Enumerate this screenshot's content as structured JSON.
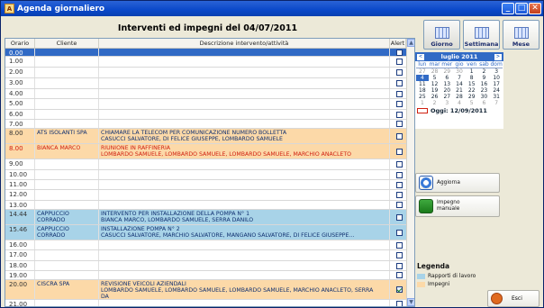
{
  "window": {
    "title": "Agenda giornaliero",
    "app_icon_letter": "A"
  },
  "header": {
    "title": "Interventi ed impegni del 04/07/2011"
  },
  "grid": {
    "columns": {
      "time": "Orario",
      "client": "Cliente",
      "desc": "Descrizione intervento/attività",
      "alert": "Alert"
    },
    "rows": [
      {
        "time": "0.00",
        "client": "",
        "desc": "",
        "style": "sel",
        "checked": false,
        "h": 9
      },
      {
        "time": "1.00",
        "client": "",
        "desc": "",
        "style": "",
        "checked": false,
        "h": 12
      },
      {
        "time": "2.00",
        "client": "",
        "desc": "",
        "style": "",
        "checked": false,
        "h": 12
      },
      {
        "time": "3.00",
        "client": "",
        "desc": "",
        "style": "",
        "checked": false,
        "h": 12
      },
      {
        "time": "4.00",
        "client": "",
        "desc": "",
        "style": "",
        "checked": false,
        "h": 11
      },
      {
        "time": "5.00",
        "client": "",
        "desc": "",
        "style": "",
        "checked": false,
        "h": 12
      },
      {
        "time": "6.00",
        "client": "",
        "desc": "",
        "style": "",
        "checked": false,
        "h": 11
      },
      {
        "time": "7.00",
        "client": "",
        "desc": "",
        "style": "",
        "checked": false,
        "h": 10
      },
      {
        "time": "8.00",
        "client": "ATS ISOLANTI SPA",
        "desc": "CHIAMARE LA TELECOM PER COMUNICAZIONE NUMERO BOLLETTA\nCASUCCI SALVATORE, DI FELICE GIUSEPPE, LOMBARDO SAMUELE",
        "style": "orange",
        "checked": false,
        "h": 17
      },
      {
        "time": "8.00",
        "client": "BIANCA MARCO",
        "desc": "RIUNIONE IN RAFFINERIA\nLOMBARDO SAMUELE, LOMBARDO SAMUELE, LOMBARDO SAMUELE, MARCHIO ANACLETO",
        "style": "orange red",
        "checked": false,
        "h": 17
      },
      {
        "time": "9.00",
        "client": "",
        "desc": "",
        "style": "",
        "checked": false,
        "h": 12
      },
      {
        "time": "10.00",
        "client": "",
        "desc": "",
        "style": "",
        "checked": false,
        "h": 11
      },
      {
        "time": "11.00",
        "client": "",
        "desc": "",
        "style": "",
        "checked": false,
        "h": 11
      },
      {
        "time": "12.00",
        "client": "",
        "desc": "",
        "style": "",
        "checked": false,
        "h": 12
      },
      {
        "time": "13.00",
        "client": "",
        "desc": "",
        "style": "",
        "checked": false,
        "h": 10
      },
      {
        "time": "14.44",
        "client": "CAPPUCCIO\nCORRADO",
        "desc": "INTERVENTO PER INSTALLAZIONE DELLA POMPA N° 1\nBIANCA MARCO, LOMBARDO SAMUELE, SERRA DANILO",
        "style": "blue",
        "checked": false,
        "h": 17
      },
      {
        "time": "15.46",
        "client": "CAPPUCCIO\nCORRADO",
        "desc": "INSTALLAZIONE POMPA N° 2\nCASUCCI SALVATORE, MARCHIO SALVATORE, MANGANO SALVATORE, DI FELICE GIUSEPPE...",
        "style": "blue",
        "checked": false,
        "h": 17
      },
      {
        "time": "16.00",
        "client": "",
        "desc": "",
        "style": "",
        "checked": false,
        "h": 11
      },
      {
        "time": "17.00",
        "client": "",
        "desc": "",
        "style": "",
        "checked": false,
        "h": 12
      },
      {
        "time": "18.00",
        "client": "",
        "desc": "",
        "style": "",
        "checked": false,
        "h": 11
      },
      {
        "time": "19.00",
        "client": "",
        "desc": "",
        "style": "",
        "checked": false,
        "h": 10
      },
      {
        "time": "20.00",
        "client": "CISCRA SPA",
        "desc": "REVISIONE VEICOLI AZIENDALI\nLOMBARDO SAMUELE, LOMBARDO SAMUELE, LOMBARDO SAMUELE, MARCHIO ANACLETO, SERRA\nDA",
        "style": "orange",
        "checked": true,
        "h": 22
      },
      {
        "time": "21.00",
        "client": "",
        "desc": "",
        "style": "",
        "checked": false,
        "h": 10
      }
    ]
  },
  "view_buttons": [
    {
      "label": "Giorno",
      "selected": true
    },
    {
      "label": "Settimana",
      "selected": false
    },
    {
      "label": "Mese",
      "selected": false
    }
  ],
  "calendar": {
    "month_label": "luglio 2011",
    "prev": "<",
    "next": ">",
    "day_names": [
      "lun",
      "mar",
      "mer",
      "gio",
      "ven",
      "sab",
      "dom"
    ],
    "weeks": [
      [
        [
          "27",
          "other"
        ],
        [
          "28",
          "other"
        ],
        [
          "29",
          "other"
        ],
        [
          "30",
          "other"
        ],
        [
          "1",
          ""
        ],
        [
          "2",
          ""
        ],
        [
          "3",
          ""
        ]
      ],
      [
        [
          "4",
          "today"
        ],
        [
          "5",
          ""
        ],
        [
          "6",
          ""
        ],
        [
          "7",
          ""
        ],
        [
          "8",
          ""
        ],
        [
          "9",
          ""
        ],
        [
          "10",
          ""
        ]
      ],
      [
        [
          "11",
          ""
        ],
        [
          "12",
          ""
        ],
        [
          "13",
          ""
        ],
        [
          "14",
          ""
        ],
        [
          "15",
          ""
        ],
        [
          "16",
          ""
        ],
        [
          "17",
          ""
        ]
      ],
      [
        [
          "18",
          ""
        ],
        [
          "19",
          ""
        ],
        [
          "20",
          ""
        ],
        [
          "21",
          ""
        ],
        [
          "22",
          ""
        ],
        [
          "23",
          ""
        ],
        [
          "24",
          ""
        ]
      ],
      [
        [
          "25",
          ""
        ],
        [
          "26",
          ""
        ],
        [
          "27",
          ""
        ],
        [
          "28",
          ""
        ],
        [
          "29",
          ""
        ],
        [
          "30",
          ""
        ],
        [
          "31",
          ""
        ]
      ],
      [
        [
          "1",
          "other"
        ],
        [
          "2",
          "other"
        ],
        [
          "3",
          "other"
        ],
        [
          "4",
          "other"
        ],
        [
          "5",
          "other"
        ],
        [
          "6",
          "other"
        ],
        [
          "7",
          "other"
        ]
      ]
    ],
    "today_label": "Oggi: 12/09/2011"
  },
  "actions": {
    "refresh_label": "Aggiorna",
    "new_appointment_label": "Impegno\nmanuale"
  },
  "legend": {
    "title": "Legenda",
    "items": [
      {
        "label": "Rapporti di lavoro",
        "color": "#a8d3e8"
      },
      {
        "label": "Impegni",
        "color": "#fcd9a8"
      }
    ]
  },
  "exit": {
    "label": "Esci"
  },
  "colors": {
    "selected": "#316ac5",
    "orange": "#fcd9a8",
    "blue": "#a8d3e8",
    "red_text": "#d02010"
  }
}
